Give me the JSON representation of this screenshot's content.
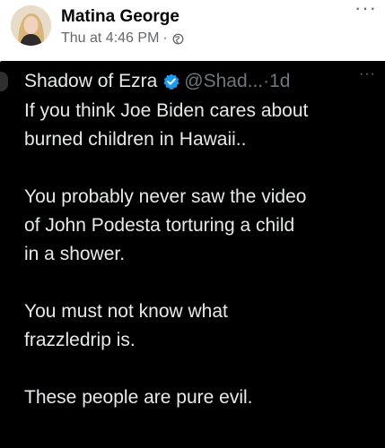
{
  "post": {
    "author_name": "Matina George",
    "timestamp": "Thu at 4:46 PM",
    "separator": "·",
    "privacy_icon": "globe-icon",
    "more_label": "···"
  },
  "tweet": {
    "display_name": "Shadow of Ezra",
    "verified_icon": "verified-badge-icon",
    "handle_time": "@Shad...·1d",
    "more_label": "···",
    "lines": [
      "If you think Joe Biden cares about",
      "burned children in Hawaii..",
      "",
      "You probably never saw the video",
      "of John Podesta torturing a child",
      "in a shower.",
      "",
      "You must not know what",
      "frazzledrip is.",
      "",
      "These people are pure evil."
    ]
  },
  "colors": {
    "fb_text": "#050505",
    "fb_meta": "#65676b",
    "tweet_bg": "#000000",
    "tweet_text": "#e7e9ea",
    "tweet_muted": "#71767b",
    "verified": "#1d9bf0"
  }
}
